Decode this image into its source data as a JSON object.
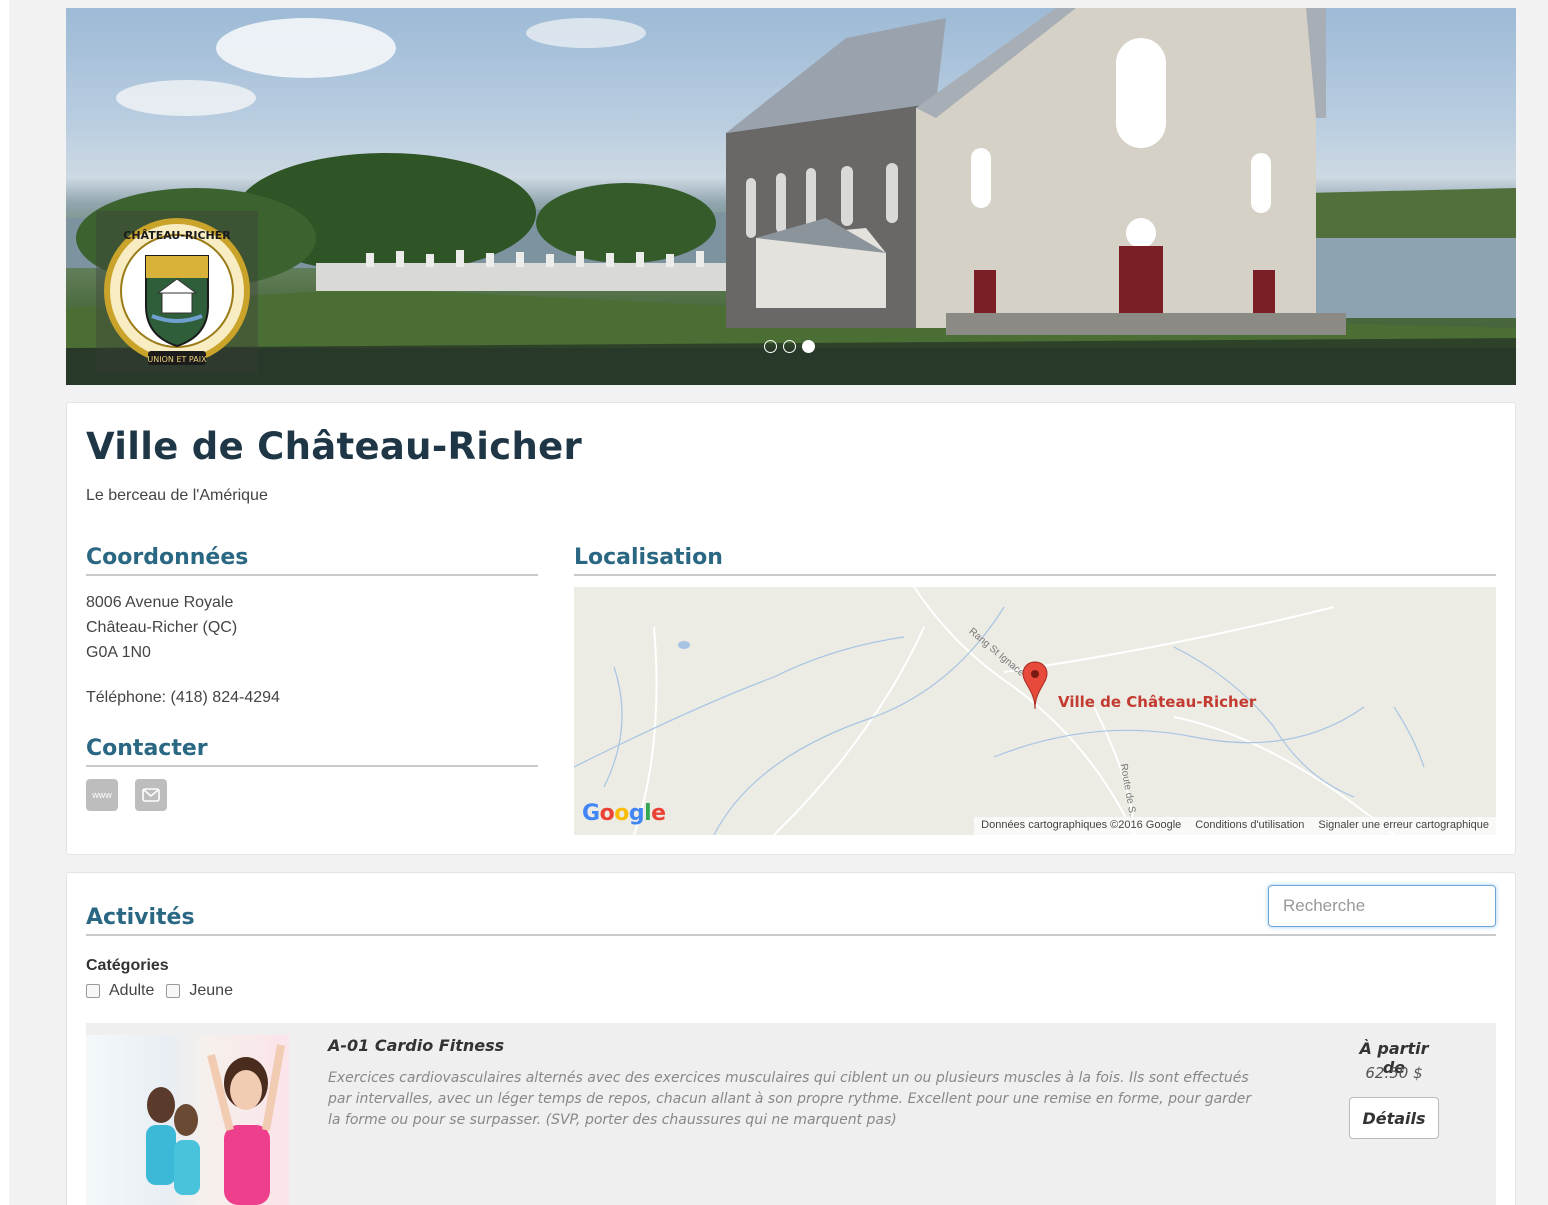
{
  "hero": {
    "logo_lettering": "VILLE de CHÂTEAU-RICHER",
    "logo_motto": "UNION ET PAIX",
    "slides": 3,
    "active_slide": 3
  },
  "city": {
    "name": "Ville de Château-Richer",
    "tagline": "Le berceau de l'Amérique"
  },
  "coordonnees": {
    "title": "Coordonnées",
    "address_line1": "8006 Avenue Royale",
    "address_line2": "Château-Richer (QC)",
    "address_line3": "G0A 1N0",
    "phone": "Téléphone: (418) 824-4294"
  },
  "contacter": {
    "title": "Contacter",
    "www_label": "www"
  },
  "localisation": {
    "title": "Localisation",
    "marker_label": "Ville de Château-Richer",
    "road1": "Rang St Ignace",
    "road2": "Route de S...",
    "footer_data": "Données cartographiques ©2016 Google",
    "footer_terms": "Conditions d'utilisation",
    "footer_report": "Signaler une erreur cartographique"
  },
  "activites": {
    "title": "Activités",
    "search_placeholder": "Recherche",
    "categories_title": "Catégories",
    "categories": [
      "Adulte",
      "Jeune"
    ],
    "items": [
      {
        "name": "A-01 Cardio Fitness",
        "description": "Exercices cardiovasculaires alternés avec des exercices musculaires qui ciblent un ou plusieurs muscles à la fois. Ils sont effectués par intervalles, avec un léger temps de repos, chacun allant à son propre rythme. Excellent pour une remise en forme, pour garder la forme ou pour se surpasser. (SVP, porter des chaussures qui ne marquent pas)",
        "price_from": "À partir de",
        "price": "62.50 $",
        "details_label": "Détails"
      }
    ]
  },
  "colors": {
    "heading": "#2a6783",
    "title": "#1e3646",
    "marker": "#c33b30"
  }
}
